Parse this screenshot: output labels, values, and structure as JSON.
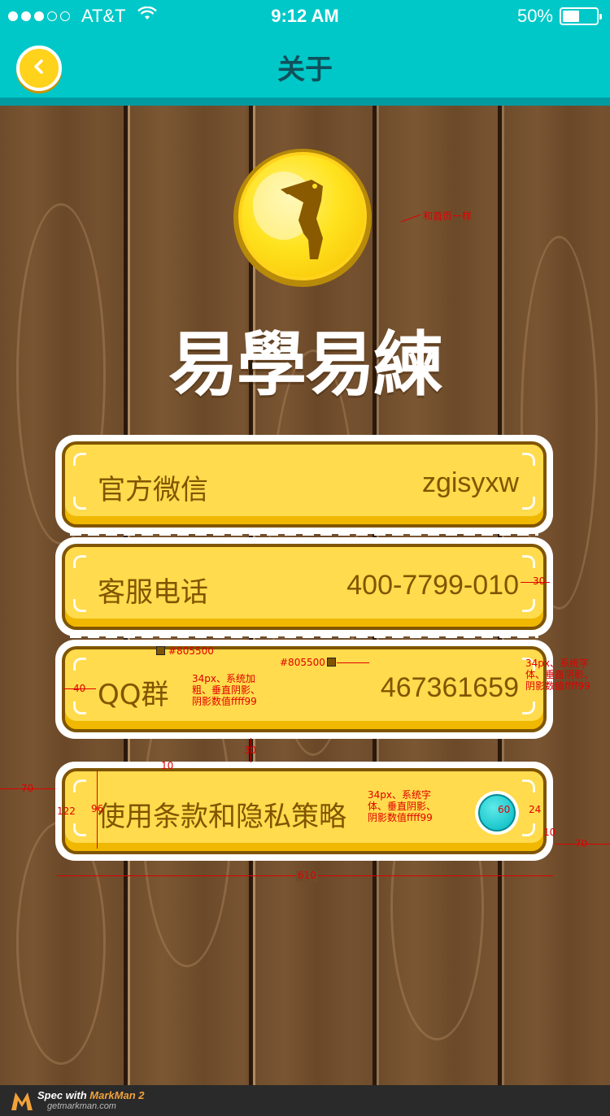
{
  "status_bar": {
    "carrier": "AT&T",
    "time": "9:12 AM",
    "battery": "50%",
    "battery_level": 0.5
  },
  "nav": {
    "title": "关于",
    "back_icon": "chevron-left-icon"
  },
  "logo": {
    "text": "易學易練",
    "icon": "woodpecker-icon"
  },
  "cards": [
    {
      "label": "官方微信",
      "value": "zgisyxw"
    },
    {
      "label": "客服电话",
      "value": "400-7799-010"
    },
    {
      "label": "QQ群",
      "value": "467361659"
    },
    {
      "label": "使用条款和隐私策略",
      "value": ""
    }
  ],
  "annotations": {
    "logo_note": "和首页一样",
    "color_label": "#805500",
    "color_value": "#805500",
    "font_bold_note": "34px、系统加粗、垂直阴影、阴影数值ffff99",
    "font_note_value": "34px、系统字体、垂直阴影、阴影数值ffff99",
    "font_note_policy": "34px、系统字体、垂直阴影、阴影数值ffff99",
    "right_margin": "30",
    "left_margin": "40",
    "gap": "30",
    "inner_pad": "10",
    "side_left": "70",
    "side_right": "70",
    "outer_height": "122",
    "inner_height": "96",
    "circle_size": "60",
    "circle_right": "24",
    "circle_bottom": "10",
    "total_width": "610"
  },
  "footer": {
    "brand_prefix": "Spec with ",
    "brand_name": "MarkMan 2",
    "url": "getmarkman.com"
  },
  "colors": {
    "teal": "#00c8c8",
    "card_yellow": "#ffdb4d",
    "text_brown": "#805500",
    "annotation_red": "#e00000"
  }
}
